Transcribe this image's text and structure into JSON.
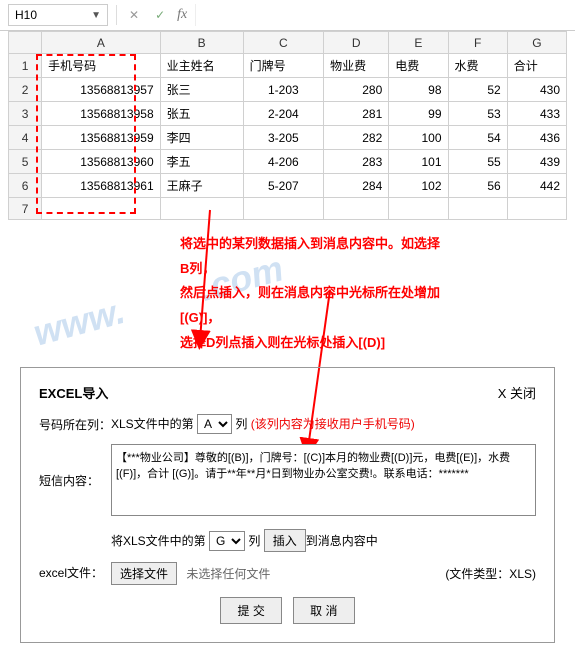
{
  "toolbar": {
    "cell_ref": "H10"
  },
  "sheet": {
    "col_headers": [
      "A",
      "B",
      "C",
      "D",
      "E",
      "F",
      "G"
    ],
    "row_headers": [
      "1",
      "2",
      "3",
      "4",
      "5",
      "6",
      "7"
    ],
    "header_row": [
      "手机号码",
      "业主姓名",
      "门牌号",
      "物业费",
      "电费",
      "水费",
      "合计"
    ],
    "rows": [
      [
        "13568813957",
        "张三",
        "1-203",
        "280",
        "98",
        "52",
        "430"
      ],
      [
        "13568813958",
        "张五",
        "2-204",
        "281",
        "99",
        "53",
        "433"
      ],
      [
        "13568813959",
        "李四",
        "3-205",
        "282",
        "100",
        "54",
        "436"
      ],
      [
        "13568813960",
        "李五",
        "4-206",
        "283",
        "101",
        "55",
        "439"
      ],
      [
        "13568813961",
        "王麻子",
        "5-207",
        "284",
        "102",
        "56",
        "442"
      ]
    ]
  },
  "instruction": {
    "line1": "将选中的某列数据插入到消息内容中。如选择B列，",
    "line2": "然后点插入，则在消息内容中光标所在处增加[(G)]，",
    "line3": "选择D列点插入则在光标处插入[(D)]"
  },
  "dialog": {
    "title": "EXCEL导入",
    "close": "X 关闭",
    "row1_label": "号码所在列：",
    "row1_prefix": "XLS文件中的第",
    "col_select_a": "A",
    "row1_suffix": "列",
    "row1_note": "(该列内容为接收用户手机号码)",
    "sms_label": "短信内容：",
    "sms_text": "【***物业公司】尊敬的[(B)]，门牌号：[(C)]本月的物业费[(D)]元，电费[(E)]，水费[(F)]，合计 [(G)]。请于**年**月*日到物业办公室交费!。联系电话：*******",
    "row3_prefix": "将XLS文件中的第",
    "col_select_g": "G",
    "row3_mid": "列",
    "insert_btn": "插入",
    "row3_suffix": "到消息内容中",
    "file_label": "excel文件：",
    "choose_file": "选择文件",
    "no_file": "未选择任何文件",
    "file_type": "(文件类型：XLS)",
    "submit": "提 交",
    "cancel": "取 消"
  }
}
